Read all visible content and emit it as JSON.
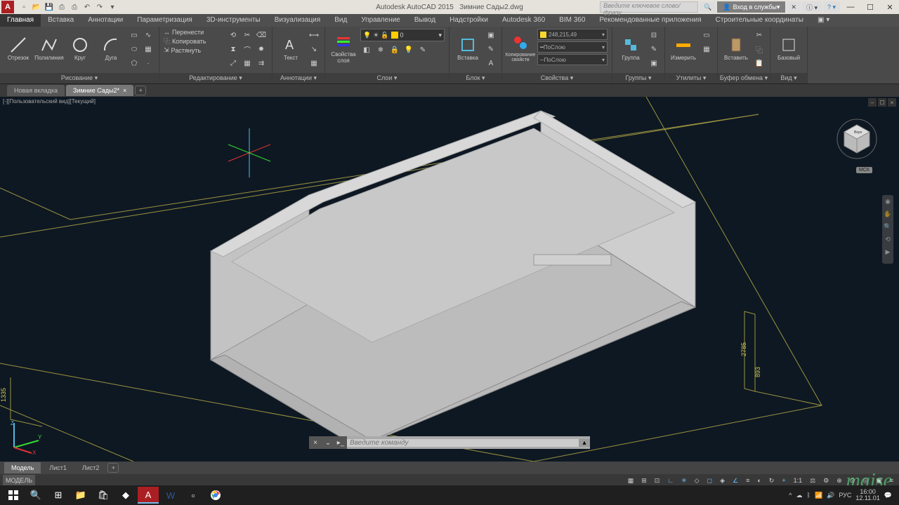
{
  "title": {
    "app": "Autodesk AutoCAD 2015",
    "file": "Зимние Сады2.dwg"
  },
  "search_placeholder": "Введите ключевое слово/фразу",
  "sign_in": "Вход в службы",
  "ribbon_tabs": [
    "Главная",
    "Вставка",
    "Аннотации",
    "Параметризация",
    "3D-инструменты",
    "Визуализация",
    "Вид",
    "Управление",
    "Вывод",
    "Надстройки",
    "Autodesk 360",
    "BIM 360",
    "Рекомендованные приложения",
    "Строительные координаты"
  ],
  "draw": {
    "line": "Отрезок",
    "polyline": "Полилиния",
    "circle": "Круг",
    "arc": "Дуга",
    "title": "Рисование"
  },
  "modify": {
    "move": "Перенести",
    "copy": "Копировать",
    "stretch": "Растянуть",
    "title": "Редактирование"
  },
  "ann": {
    "text": "Текст",
    "title": "Аннотации"
  },
  "layers": {
    "title": "Слои",
    "props": "Свойства слоя",
    "current": "0"
  },
  "block": {
    "insert": "Вставка",
    "title": "Блок"
  },
  "props": {
    "match": "Копирование свойств",
    "bylayer": "ПоСлою",
    "color": "248,215,49",
    "title": "Свойства"
  },
  "groups": {
    "group": "Группа",
    "title": "Группы"
  },
  "utils": {
    "measure": "Измерить",
    "title": "Утилиты"
  },
  "clip": {
    "paste": "Вставить",
    "title": "Буфер обмена"
  },
  "view": {
    "base": "Базовый",
    "title": "Вид"
  },
  "doc_tabs": {
    "new": "Новая вкладка",
    "current": "Зимние Сады2*"
  },
  "vp": {
    "label": "[-][Пользовательский вид][Текущий]",
    "wcs": "МСК"
  },
  "cmd_placeholder": "Введите команду",
  "layout": {
    "model": "Модель",
    "l1": "Лист1",
    "l2": "Лист2"
  },
  "status": {
    "model": "МОДЕЛЬ",
    "scale": "1:1"
  },
  "dims": {
    "d1": "2785",
    "d2": "893",
    "d3": "1335"
  },
  "tray": {
    "lang": "РУС",
    "time": "16:00",
    "date": "12.11.01"
  },
  "watermark": "maise"
}
